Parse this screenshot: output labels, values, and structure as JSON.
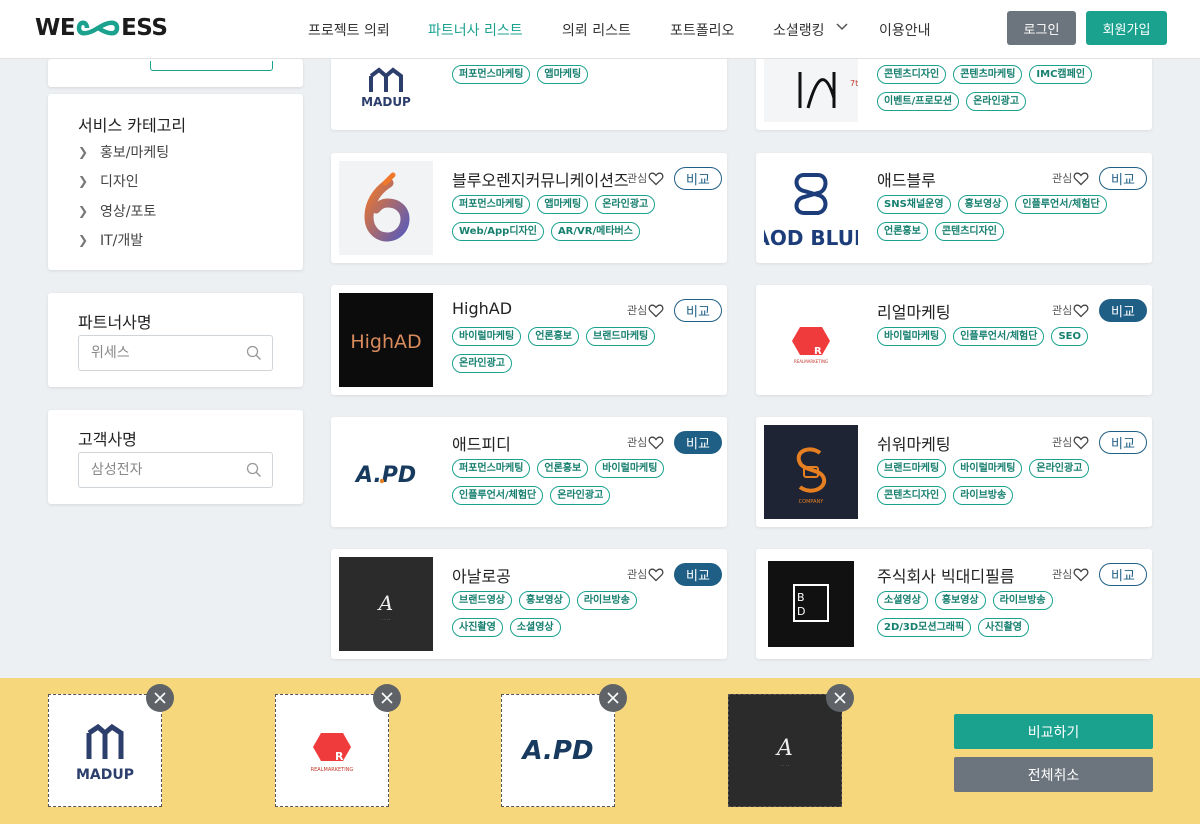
{
  "header": {
    "logo": "WECOESS",
    "nav": [
      {
        "label": "프로젝트 의뢰",
        "active": false
      },
      {
        "label": "파트너사 리스트",
        "active": true
      },
      {
        "label": "의뢰 리스트",
        "active": false
      },
      {
        "label": "포트폴리오",
        "active": false
      },
      {
        "label": "소셜랭킹",
        "active": false,
        "dropdown": true
      },
      {
        "label": "이용안내",
        "active": false
      }
    ],
    "login": "로그인",
    "join": "회원가입"
  },
  "sidebar": {
    "category": {
      "title": "서비스 카테고리",
      "items": [
        "홍보/마케팅",
        "디자인",
        "영상/포토",
        "IT/개발"
      ]
    },
    "partner_search": {
      "title": "파트너사명",
      "placeholder": "위세스"
    },
    "client_search": {
      "title": "고객사명",
      "placeholder": "삼성전자"
    }
  },
  "partners": [
    {
      "name": "",
      "logo": "MADUP",
      "like": "",
      "compare": "",
      "selected": false,
      "tags": [
        [
          "퍼포먼스마케팅",
          "앱마케팅"
        ]
      ]
    },
    {
      "name": "",
      "logo": "IK",
      "like": "",
      "compare": "",
      "selected": false,
      "tags": [
        [
          "콘텐츠디자인",
          "콘텐츠마케팅",
          "IMC캠페인"
        ],
        [
          "이벤트/프로모션",
          "온라인광고"
        ]
      ]
    },
    {
      "name": "블루오렌지커뮤니케이션즈",
      "logo": "blue-orange",
      "like": "관심",
      "compare": "비교",
      "selected": false,
      "tags": [
        [
          "퍼포먼스마케팅",
          "앱마케팅",
          "온라인광고"
        ],
        [
          "Web/App디자인",
          "AR/VR/메타버스"
        ]
      ]
    },
    {
      "name": "애드블루",
      "logo": "AOD BLUE",
      "like": "관심",
      "compare": "비교",
      "selected": false,
      "tags": [
        [
          "SNS채널운영",
          "홍보영상",
          "인플루언서/체험단"
        ],
        [
          "언론홍보",
          "콘텐츠디자인"
        ]
      ]
    },
    {
      "name": "HighAD",
      "logo": "HighAD",
      "like": "관심",
      "compare": "비교",
      "selected": false,
      "tags": [
        [
          "바이럴마케팅",
          "언론홍보",
          "브랜드마케팅"
        ],
        [
          "온라인광고"
        ]
      ]
    },
    {
      "name": "리얼마케팅",
      "logo": "R",
      "like": "관심",
      "compare": "비교",
      "selected": true,
      "tags": [
        [
          "바이럴마케팅",
          "인플루언서/체험단",
          "SEO"
        ]
      ]
    },
    {
      "name": "애드피디",
      "logo": "A.PD",
      "like": "관심",
      "compare": "비교",
      "selected": true,
      "tags": [
        [
          "퍼포먼스마케팅",
          "언론홍보",
          "바이럴마케팅"
        ],
        [
          "인플루언서/체험단",
          "온라인광고"
        ]
      ]
    },
    {
      "name": "쉬워마케팅",
      "logo": "swirl",
      "like": "관심",
      "compare": "비교",
      "selected": false,
      "tags": [
        [
          "브랜드마케팅",
          "바이럴마케팅",
          "온라인광고"
        ],
        [
          "콘텐츠디자인",
          "라이브방송"
        ]
      ]
    },
    {
      "name": "아날로공",
      "logo": "A",
      "like": "관심",
      "compare": "비교",
      "selected": true,
      "tags": [
        [
          "브랜드영상",
          "홍보영상",
          "라이브방송"
        ],
        [
          "사진촬영",
          "소셜영상"
        ]
      ]
    },
    {
      "name": "주식회사 빅대디필름",
      "logo": "BD",
      "like": "관심",
      "compare": "비교",
      "selected": false,
      "tags": [
        [
          "소셜영상",
          "홍보영상",
          "라이브방송"
        ],
        [
          "2D/3D모션그래픽",
          "사진촬영"
        ]
      ]
    }
  ],
  "compare_bar": {
    "slots": [
      "MADUP",
      "REALMARKETING",
      "A.PD",
      "A"
    ],
    "compare_label": "비교하기",
    "cancel_label": "전체취소"
  },
  "colors": {
    "accent": "#1aa28f",
    "selected": "#1f5f86",
    "compare_bar": "#f6d77c"
  }
}
